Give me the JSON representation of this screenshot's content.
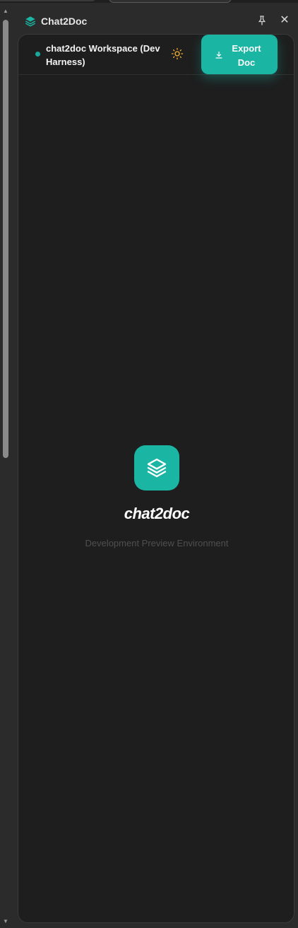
{
  "panel": {
    "title": "Chat2Doc",
    "pin_icon": "pin-icon",
    "close_icon": "close-icon",
    "close_glyph": "✕"
  },
  "workspace": {
    "title": "chat2doc Workspace (Dev Harness)",
    "status_color": "#1aa89a",
    "theme_icon": "sun-icon",
    "export_label": "Export Doc",
    "export_icon": "download-icon"
  },
  "hero": {
    "logo_icon": "layers-icon",
    "brand": "chat2doc",
    "subtitle": "Development Preview Environment"
  },
  "colors": {
    "accent": "#1bb5a4",
    "background": "#1e1e1e",
    "sun": "#f2b233"
  },
  "scrollbar": {
    "up_glyph": "▲",
    "down_glyph": "▼"
  }
}
